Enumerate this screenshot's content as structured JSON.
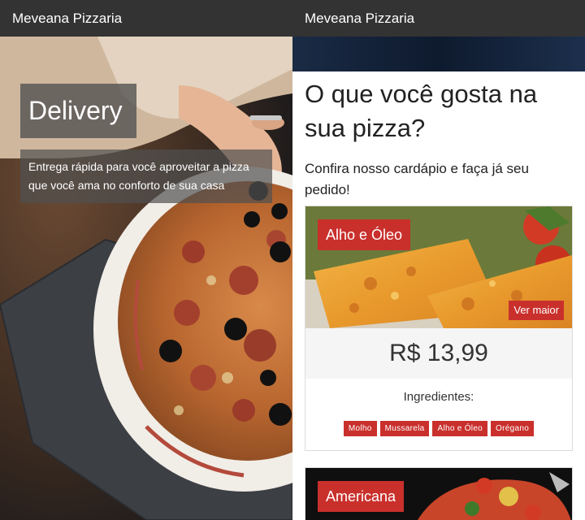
{
  "left": {
    "brand": "Meveana Pizzaria",
    "hero_title": "Delivery",
    "hero_text": "Entrega rápida para você aproveitar a pizza que você ama no conforto de sua casa"
  },
  "right": {
    "brand": "Meveana Pizzaria",
    "heading": "O que você gosta na sua pizza?",
    "subheading": "Confira nosso cardápio e faça já seu pedido!",
    "products": [
      {
        "name": "Alho e Óleo",
        "more_label": "Ver maior",
        "price": "R$ 13,99",
        "ingredients_label": "Ingredientes:",
        "ingredients": [
          "Molho",
          "Mussarela",
          "Alho e Óleo",
          "Orégano"
        ]
      },
      {
        "name": "Americana"
      }
    ]
  },
  "colors": {
    "navbar": "#333333",
    "accent": "#c9302c",
    "price_bg": "#f5f5f5"
  }
}
